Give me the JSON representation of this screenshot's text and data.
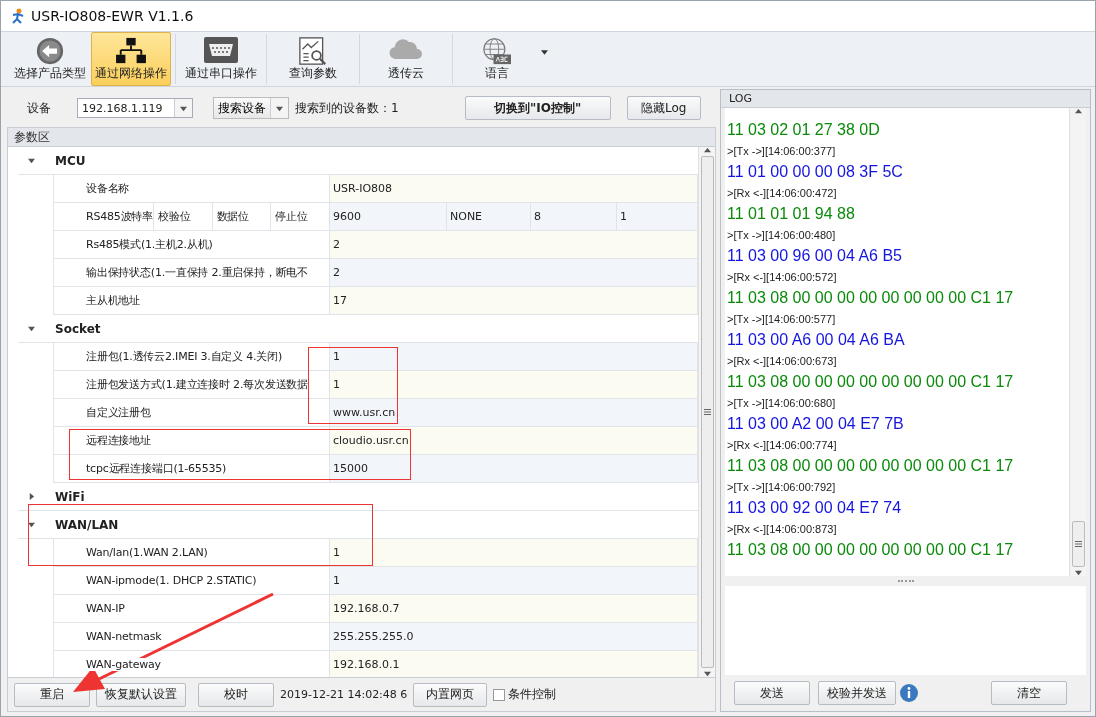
{
  "window": {
    "title": "USR-IO808-EWR V1.1.6"
  },
  "toolbar": [
    {
      "label": "选择产品类型",
      "selected": false
    },
    {
      "label": "通过网络操作",
      "selected": true
    },
    {
      "label": "通过串口操作",
      "selected": false
    },
    {
      "label": "查询参数",
      "selected": false
    },
    {
      "label": "透传云",
      "selected": false
    },
    {
      "label": "语言",
      "selected": false,
      "dropdown": true
    }
  ],
  "device_bar": {
    "device_label": "设备",
    "device_value": "192.168.1.119",
    "search_button": "搜索设备",
    "found_label": "搜索到的设备数：",
    "found_count": "1",
    "switch_button": "切换到\"IO控制\"",
    "hide_log_button": "隐藏Log"
  },
  "params": {
    "title": "参数区",
    "groups": [
      {
        "name": "MCU",
        "expanded": true,
        "rows": [
          {
            "labels": [
              "设备名称"
            ],
            "values": [
              "USR-IO808"
            ]
          },
          {
            "labels": [
              "RS485波特率",
              "校验位",
              "数据位",
              "停止位"
            ],
            "values": [
              "9600",
              "NONE",
              "8",
              "1"
            ]
          },
          {
            "labels": [
              "Rs485模式(1.主机2.从机)"
            ],
            "values": [
              "2"
            ]
          },
          {
            "labels": [
              "输出保持状态(1.一直保持 2.重启保持，断电不"
            ],
            "values": [
              "2"
            ]
          },
          {
            "labels": [
              "主从机地址"
            ],
            "values": [
              "17"
            ]
          }
        ]
      },
      {
        "name": "Socket",
        "expanded": true,
        "rows": [
          {
            "labels": [
              "注册包(1.透传云2.IMEI 3.自定义 4.关闭)"
            ],
            "values": [
              "1"
            ]
          },
          {
            "labels": [
              "注册包发送方式(1.建立连接时 2.每次发送数据"
            ],
            "values": [
              "1"
            ]
          },
          {
            "labels": [
              "自定义注册包"
            ],
            "values": [
              "www.usr.cn"
            ]
          },
          {
            "labels": [
              "远程连接地址"
            ],
            "values": [
              "cloudio.usr.cn"
            ]
          },
          {
            "labels": [
              "tcpc远程连接端口(1-65535)"
            ],
            "values": [
              "15000"
            ]
          }
        ]
      },
      {
        "name": "WiFi",
        "expanded": false
      },
      {
        "name": "WAN/LAN",
        "expanded": true,
        "rows": [
          {
            "labels": [
              "Wan/lan(1.WAN 2.LAN)"
            ],
            "values": [
              "1"
            ]
          },
          {
            "labels": [
              "WAN-ipmode(1. DHCP 2.STATIC)"
            ],
            "values": [
              "1"
            ]
          },
          {
            "labels": [
              "WAN-IP"
            ],
            "values": [
              "192.168.0.7"
            ]
          },
          {
            "labels": [
              "WAN-netmask"
            ],
            "values": [
              "255.255.255.0"
            ]
          },
          {
            "labels": [
              "WAN-gateway"
            ],
            "values": [
              "192.168.0.1"
            ]
          }
        ]
      }
    ]
  },
  "bottom_bar": {
    "buttons": [
      "重启",
      "恢复默认设置",
      "校时"
    ],
    "timestamp": "2019-12-21 14:02:48 6",
    "web_button": "内置网页",
    "condition": {
      "label": "条件控制",
      "checked": false
    }
  },
  "log": {
    "title": "LOG",
    "entries": [
      {
        "kind": "rx",
        "text": "11 03 02 01 27 38 0D"
      },
      {
        "kind": "meta",
        "text": ">[Tx ->][14:06:00:377]"
      },
      {
        "kind": "tx",
        "text": "11 01 00 00 00 08 3F 5C"
      },
      {
        "kind": "meta",
        "text": ">[Rx <-][14:06:00:472]"
      },
      {
        "kind": "rx",
        "text": "11 01 01 01 94 88"
      },
      {
        "kind": "meta",
        "text": ">[Tx ->][14:06:00:480]"
      },
      {
        "kind": "tx",
        "text": "11 03 00 96 00 04 A6 B5"
      },
      {
        "kind": "meta",
        "text": ">[Rx <-][14:06:00:572]"
      },
      {
        "kind": "rx",
        "text": "11 03 08 00 00 00 00 00 00 00 00 C1 17"
      },
      {
        "kind": "meta",
        "text": ">[Tx ->][14:06:00:577]"
      },
      {
        "kind": "tx",
        "text": "11 03 00 A6 00 04 A6 BA"
      },
      {
        "kind": "meta",
        "text": ">[Rx <-][14:06:00:673]"
      },
      {
        "kind": "rx",
        "text": "11 03 08 00 00 00 00 00 00 00 00 C1 17"
      },
      {
        "kind": "meta",
        "text": ">[Tx ->][14:06:00:680]"
      },
      {
        "kind": "tx",
        "text": "11 03 00 A2 00 04 E7 7B"
      },
      {
        "kind": "meta",
        "text": ">[Rx <-][14:06:00:774]"
      },
      {
        "kind": "rx",
        "text": "11 03 08 00 00 00 00 00 00 00 00 C1 17"
      },
      {
        "kind": "meta",
        "text": ">[Tx ->][14:06:00:792]"
      },
      {
        "kind": "tx",
        "text": "11 03 00 92 00 04 E7 74"
      },
      {
        "kind": "meta",
        "text": ">[Rx <-][14:06:00:873]"
      },
      {
        "kind": "rx",
        "text": "11 03 08 00 00 00 00 00 00 00 00 C1 17"
      }
    ],
    "buttons": [
      "发送",
      "校验并发送",
      "清空"
    ]
  }
}
